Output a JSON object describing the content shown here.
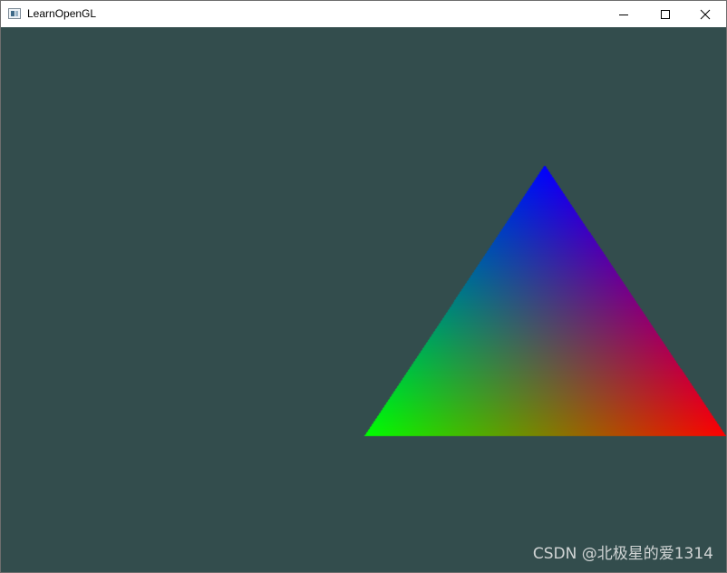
{
  "window": {
    "title": "LearnOpenGL",
    "icon": "app-window-icon",
    "controls": {
      "minimize": "minimize-icon",
      "maximize": "maximize-icon",
      "close": "close-icon"
    }
  },
  "scene": {
    "clear_color": "#334d4d",
    "triangle": {
      "vertex_colors": {
        "top": "#0000ff",
        "bottom_left": "#00ff00",
        "bottom_right": "#ff0000"
      }
    }
  },
  "watermark": {
    "text": "CSDN @北极星的爱1314"
  }
}
